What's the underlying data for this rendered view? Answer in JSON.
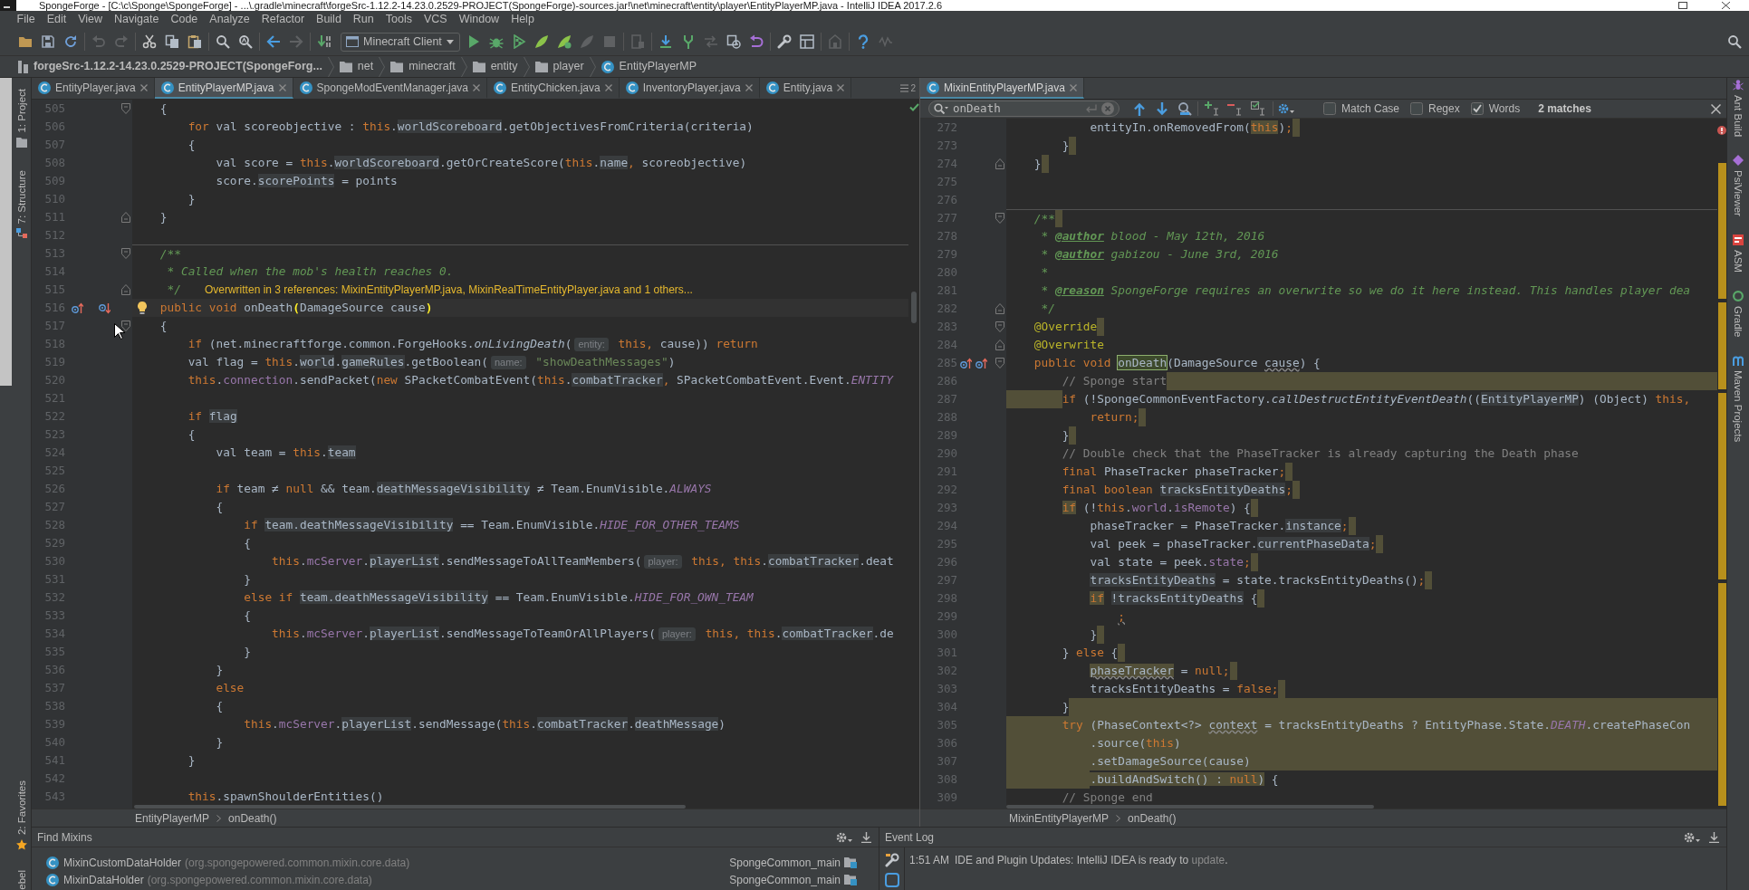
{
  "window": {
    "title": "SpongeForge - [C:\\c\\Sponge\\SpongeForge] - ...\\.gradle\\minecraft\\forgeSrc-1.12.2-14.23.0.2529-PROJECT(SpongeForge)-sources.jar!\\net\\minecraft\\entity\\player\\EntityPlayerMP.java - IntelliJ IDEA 2017.2.6"
  },
  "menu": [
    "File",
    "Edit",
    "View",
    "Navigate",
    "Code",
    "Analyze",
    "Refactor",
    "Build",
    "Run",
    "Tools",
    "VCS",
    "Window",
    "Help"
  ],
  "toolbar": [
    {
      "kind": "open",
      "disabled": false
    },
    {
      "kind": "save",
      "disabled": false
    },
    {
      "kind": "sync",
      "disabled": false
    },
    {
      "kind": "separator"
    },
    {
      "kind": "undo",
      "disabled": true
    },
    {
      "kind": "redo",
      "disabled": true
    },
    {
      "kind": "separator"
    },
    {
      "kind": "cut",
      "disabled": false
    },
    {
      "kind": "copy",
      "disabled": false
    },
    {
      "kind": "paste",
      "disabled": false
    },
    {
      "kind": "separator"
    },
    {
      "kind": "find",
      "disabled": false
    },
    {
      "kind": "replace",
      "disabled": false
    },
    {
      "kind": "separator"
    },
    {
      "kind": "back",
      "disabled": false
    },
    {
      "kind": "forward",
      "disabled": true
    },
    {
      "kind": "separator"
    },
    {
      "kind": "build",
      "disabled": false
    },
    {
      "kind": "run_config",
      "label": "Minecraft Client"
    },
    {
      "kind": "run",
      "disabled": false
    },
    {
      "kind": "debug",
      "disabled": false
    },
    {
      "kind": "coverage",
      "disabled": false
    },
    {
      "kind": "launch",
      "disabled": false
    },
    {
      "kind": "launch_debug",
      "disabled": false
    },
    {
      "kind": "profile",
      "disabled": true
    },
    {
      "kind": "stop",
      "disabled": true
    },
    {
      "kind": "separator"
    },
    {
      "kind": "module",
      "disabled": true
    },
    {
      "kind": "separator"
    },
    {
      "kind": "vcs_update",
      "disabled": false
    },
    {
      "kind": "vcs_commit",
      "disabled": false
    },
    {
      "kind": "compare",
      "disabled": true
    },
    {
      "kind": "history",
      "disabled": false
    },
    {
      "kind": "revert",
      "disabled": false
    },
    {
      "kind": "separator"
    },
    {
      "kind": "settings",
      "disabled": false
    },
    {
      "kind": "structure",
      "disabled": false
    },
    {
      "kind": "separator"
    },
    {
      "kind": "sdk",
      "disabled": true
    },
    {
      "kind": "separator"
    },
    {
      "kind": "help",
      "disabled": false
    },
    {
      "kind": "activity",
      "disabled": true
    },
    {
      "kind": "search_everywhere",
      "disabled": false
    }
  ],
  "navigation": {
    "project": "forgeSrc-1.12.2-14.23.0.2529-PROJECT(SpongeForg...",
    "path": [
      {
        "kind": "folder",
        "label": "net"
      },
      {
        "kind": "folder",
        "label": "minecraft"
      },
      {
        "kind": "folder",
        "label": "entity"
      },
      {
        "kind": "folder",
        "label": "player"
      },
      {
        "kind": "class",
        "label": "EntityPlayerMP"
      }
    ]
  },
  "left_strip": {
    "top": [
      {
        "kind": "project",
        "label": "1: Project"
      },
      {
        "kind": "structure",
        "label": "7: Structure"
      }
    ],
    "bottom": [
      {
        "kind": "favorites",
        "label": "2: Favorites"
      },
      {
        "label": "ebel"
      }
    ]
  },
  "right_strip": [
    {
      "kind": "ant",
      "label": "Ant Build"
    },
    {
      "kind": "psi",
      "label": "PsiViewer"
    },
    {
      "kind": "asm",
      "label": "ASM"
    },
    {
      "kind": "gradle",
      "label": "Gradle"
    },
    {
      "kind": "maven",
      "label": "Maven Projects"
    }
  ],
  "editors": [
    {
      "tabs": [
        {
          "label": "EntityPlayer.java",
          "selected": false
        },
        {
          "label": "EntityPlayerMP.java",
          "selected": true
        },
        {
          "label": "SpongeModEventManager.java",
          "selected": false
        },
        {
          "label": "EntityChicken.java",
          "selected": false
        },
        {
          "label": "InventoryPlayer.java",
          "selected": false
        },
        {
          "label": "Entity.java",
          "selected": false
        }
      ],
      "hidden_tab_count": "2",
      "status": {
        "kind": "ok"
      },
      "lines": [
        {
          "number": "505",
          "fold": {
            "kind": "start"
          },
          "code": [
            {
              "text": "    {"
            }
          ]
        },
        {
          "number": "506",
          "code": [
            {
              "text": "        for",
              "kind": "keyword"
            },
            {
              "text": " val scoreobjective : "
            },
            {
              "text": "this",
              "kind": "keyword"
            },
            {
              "text": "."
            },
            {
              "text": "worldScoreboard",
              "folded": true
            },
            {
              "text": ".getObjectivesFromCriteria(criteria)"
            }
          ]
        },
        {
          "number": "507",
          "code": [
            {
              "text": "        {"
            }
          ]
        },
        {
          "number": "508",
          "code": [
            {
              "text": "            val score = "
            },
            {
              "text": "this",
              "kind": "keyword"
            },
            {
              "text": "."
            },
            {
              "text": "worldScoreboard",
              "folded": true
            },
            {
              "text": ".getOrCreateScore("
            },
            {
              "text": "this",
              "kind": "keyword"
            },
            {
              "text": "."
            },
            {
              "text": "name",
              "folded": true
            },
            {
              "text": ",",
              "kind": "keyword"
            },
            {
              "text": " scoreobjective)"
            }
          ]
        },
        {
          "number": "509",
          "code": [
            {
              "text": "            score."
            },
            {
              "text": "scorePoints",
              "folded": true
            },
            {
              "text": " = points"
            }
          ]
        },
        {
          "number": "510",
          "code": [
            {
              "text": "        }"
            }
          ]
        },
        {
          "number": "511",
          "fold": {
            "kind": "end"
          },
          "code": [
            {
              "text": "    }"
            }
          ]
        },
        {
          "number": "512"
        },
        {
          "number": "513",
          "separator": true,
          "fold": {
            "kind": "start"
          },
          "code": [
            {
              "text": "    /**",
              "kind": "doc"
            }
          ]
        },
        {
          "number": "514",
          "code": [
            {
              "text": "     * Called when the mob's health reaches 0.",
              "kind": "doc"
            }
          ]
        },
        {
          "number": "515",
          "fold": {
            "kind": "end"
          },
          "code": [
            {
              "text": "     */",
              "kind": "doc"
            }
          ],
          "inlay": "Overwritten in 3 references: MixinEntityPlayerMP.java, MixinRealTimeEntityPlayer.java and 1 others..."
        },
        {
          "number": "516",
          "current": true,
          "gutter": [
            {
              "kind": "up"
            },
            {
              "kind": "down"
            }
          ],
          "bulb": true,
          "code": [
            {
              "text": "    public void",
              "kind": "keyword"
            },
            {
              "text": " onDeath"
            },
            {
              "text": "(",
              "kind": "brace"
            },
            {
              "text": "DamageSource cause"
            },
            {
              "text": ")",
              "kind": "brace"
            }
          ]
        },
        {
          "number": "517",
          "fold": {
            "kind": "start"
          },
          "code": [
            {
              "text": "    {"
            }
          ]
        },
        {
          "number": "518",
          "code": [
            {
              "text": "        if",
              "kind": "keyword"
            },
            {
              "text": " (net.minecraftforge.common.ForgeHooks."
            },
            {
              "text": "onLivingDeath",
              "kind": "static"
            },
            {
              "text": "("
            },
            {
              "text": "entity:",
              "kind": "hint"
            },
            {
              "text": " this,",
              "kind": "keyword"
            },
            {
              "text": " cause)) "
            },
            {
              "text": "return",
              "kind": "keyword"
            }
          ]
        },
        {
          "number": "519",
          "code": [
            {
              "text": "        val flag = "
            },
            {
              "text": "this",
              "kind": "keyword"
            },
            {
              "text": "."
            },
            {
              "text": "world",
              "folded": true
            },
            {
              "text": "."
            },
            {
              "text": "gameRules",
              "folded": true
            },
            {
              "text": ".getBoolean("
            },
            {
              "text": "name:",
              "kind": "hint"
            },
            {
              "text": " \"showDeathMessages\"",
              "kind": "string"
            },
            {
              "text": ")"
            }
          ]
        },
        {
          "number": "520",
          "code": [
            {
              "text": "        this",
              "kind": "keyword"
            },
            {
              "text": "."
            },
            {
              "text": "connection",
              "kind": "field"
            },
            {
              "text": ".sendPacket("
            },
            {
              "text": "new",
              "kind": "keyword"
            },
            {
              "text": " SPacketCombatEvent("
            },
            {
              "text": "this",
              "kind": "keyword"
            },
            {
              "text": "."
            },
            {
              "text": "combatTracker",
              "folded": true
            },
            {
              "text": ",",
              "kind": "keyword"
            },
            {
              "text": " SPacketCombatEvent.Event."
            },
            {
              "text": "ENTITY",
              "kind": "constant"
            }
          ]
        },
        {
          "number": "521"
        },
        {
          "number": "522",
          "code": [
            {
              "text": "        if ",
              "kind": "keyword"
            },
            {
              "text": "flag",
              "folded": true
            }
          ]
        },
        {
          "number": "523",
          "code": [
            {
              "text": "        {"
            }
          ]
        },
        {
          "number": "524",
          "code": [
            {
              "text": "            val team = "
            },
            {
              "text": "this",
              "kind": "keyword"
            },
            {
              "text": "."
            },
            {
              "text": "team",
              "folded": true
            }
          ]
        },
        {
          "number": "525"
        },
        {
          "number": "526",
          "code": [
            {
              "text": "            if ",
              "kind": "keyword"
            },
            {
              "text": "team ≠ "
            },
            {
              "text": "null",
              "kind": "keyword"
            },
            {
              "text": " && team."
            },
            {
              "text": "deathMessageVisibility",
              "folded": true
            },
            {
              "text": " ≠ Team.EnumVisible."
            },
            {
              "text": "ALWAYS",
              "kind": "constant"
            }
          ]
        },
        {
          "number": "527",
          "code": [
            {
              "text": "            {"
            }
          ]
        },
        {
          "number": "528",
          "code": [
            {
              "text": "                if ",
              "kind": "keyword"
            },
            {
              "text": "team.deathMessageVisibility",
              "folded": true
            },
            {
              "text": " == Team.EnumVisible."
            },
            {
              "text": "HIDE_FOR_OTHER_TEAMS",
              "kind": "constant"
            }
          ]
        },
        {
          "number": "529",
          "code": [
            {
              "text": "                {"
            }
          ]
        },
        {
          "number": "530",
          "code": [
            {
              "text": "                    this",
              "kind": "keyword"
            },
            {
              "text": "."
            },
            {
              "text": "mcServer",
              "kind": "field"
            },
            {
              "text": "."
            },
            {
              "text": "playerList",
              "folded": true
            },
            {
              "text": ".sendMessageToAllTeamMembers("
            },
            {
              "text": "player:",
              "kind": "hint"
            },
            {
              "text": " this, this",
              "kind": "keyword"
            },
            {
              "text": "."
            },
            {
              "text": "combatTracker",
              "folded": true
            },
            {
              "text": ".deat"
            }
          ]
        },
        {
          "number": "531",
          "code": [
            {
              "text": "                }"
            }
          ]
        },
        {
          "number": "532",
          "code": [
            {
              "text": "                else if ",
              "kind": "keyword"
            },
            {
              "text": "team.deathMessageVisibility",
              "folded": true
            },
            {
              "text": " == Team.EnumVisible."
            },
            {
              "text": "HIDE_FOR_OWN_TEAM",
              "kind": "constant"
            }
          ]
        },
        {
          "number": "533",
          "code": [
            {
              "text": "                {"
            }
          ]
        },
        {
          "number": "534",
          "code": [
            {
              "text": "                    this",
              "kind": "keyword"
            },
            {
              "text": "."
            },
            {
              "text": "mcServer",
              "kind": "field"
            },
            {
              "text": "."
            },
            {
              "text": "playerList",
              "folded": true
            },
            {
              "text": ".sendMessageToTeamOrAllPlayers("
            },
            {
              "text": "player:",
              "kind": "hint"
            },
            {
              "text": " this, this",
              "kind": "keyword"
            },
            {
              "text": "."
            },
            {
              "text": "combatTracker",
              "folded": true
            },
            {
              "text": ".de"
            }
          ]
        },
        {
          "number": "535",
          "code": [
            {
              "text": "                }"
            }
          ]
        },
        {
          "number": "536",
          "code": [
            {
              "text": "            }"
            }
          ]
        },
        {
          "number": "537",
          "code": [
            {
              "text": "            else",
              "kind": "keyword"
            }
          ]
        },
        {
          "number": "538",
          "code": [
            {
              "text": "            {"
            }
          ]
        },
        {
          "number": "539",
          "code": [
            {
              "text": "                this",
              "kind": "keyword"
            },
            {
              "text": "."
            },
            {
              "text": "mcServer",
              "kind": "field"
            },
            {
              "text": "."
            },
            {
              "text": "playerList",
              "folded": true
            },
            {
              "text": ".sendMessage("
            },
            {
              "text": "this",
              "kind": "keyword"
            },
            {
              "text": "."
            },
            {
              "text": "combatTracker",
              "folded": true
            },
            {
              "text": "."
            },
            {
              "text": "deathMessage",
              "folded": true
            },
            {
              "text": ")"
            }
          ]
        },
        {
          "number": "540",
          "code": [
            {
              "text": "            }"
            }
          ]
        },
        {
          "number": "541",
          "code": [
            {
              "text": "        }"
            }
          ]
        },
        {
          "number": "542"
        },
        {
          "number": "543",
          "code": [
            {
              "text": "        this",
              "kind": "keyword"
            },
            {
              "text": ".spawnShoulderEntities()"
            }
          ]
        }
      ],
      "breadcrumb": [
        "EntityPlayerMP",
        "onDeath()"
      ]
    },
    {
      "tabs": [
        {
          "label": "MixinEntityPlayerMP.java",
          "selected": true
        }
      ],
      "status": {
        "kind": "error"
      },
      "search": {
        "query": "onDeath",
        "options": [
          {
            "label": "Match Case",
            "checked": false
          },
          {
            "label": "Regex",
            "checked": false
          },
          {
            "label": "Words",
            "checked": true
          }
        ],
        "result": "2 matches"
      },
      "lines": [
        {
          "number": "272",
          "band": {
            "kind": "trail"
          },
          "code": [
            {
              "text": "            entityIn.onRemovedFrom("
            },
            {
              "text": "this",
              "kind": "keyword",
              "highlighted": true
            },
            {
              "text": ")"
            },
            {
              "text": ";",
              "kind": "keyword"
            }
          ]
        },
        {
          "number": "273",
          "band": {
            "kind": "trail"
          },
          "code": [
            {
              "text": "        }"
            }
          ]
        },
        {
          "number": "274",
          "band": {
            "kind": "trail"
          },
          "fold": {
            "kind": "end"
          },
          "code": [
            {
              "text": "    }"
            }
          ]
        },
        {
          "number": "275"
        },
        {
          "number": "276"
        },
        {
          "number": "277",
          "separator": true,
          "fold": {
            "kind": "start"
          },
          "band": {
            "kind": "trail"
          },
          "code": [
            {
              "text": "    /**",
              "kind": "doc"
            }
          ]
        },
        {
          "number": "278",
          "code": [
            {
              "text": "     * ",
              "kind": "doc"
            },
            {
              "text": "@author",
              "kind": "doctag"
            },
            {
              "text": " blood - May 12th, 2016",
              "kind": "doc"
            }
          ]
        },
        {
          "number": "279",
          "code": [
            {
              "text": "     * ",
              "kind": "doc"
            },
            {
              "text": "@author",
              "kind": "doctag"
            },
            {
              "text": " gabizou - June 3rd, 2016",
              "kind": "doc"
            }
          ]
        },
        {
          "number": "280",
          "code": [
            {
              "text": "     *",
              "kind": "doc"
            }
          ]
        },
        {
          "number": "281",
          "code": [
            {
              "text": "     * ",
              "kind": "doc"
            },
            {
              "text": "@reason",
              "kind": "doctag"
            },
            {
              "text": " SpongeForge requires an overwrite so we do it here instead. This handles player dea",
              "kind": "doc"
            }
          ]
        },
        {
          "number": "282",
          "fold": {
            "kind": "end"
          },
          "code": [
            {
              "text": "     */",
              "kind": "doc"
            }
          ]
        },
        {
          "number": "283",
          "fold": {
            "kind": "start"
          },
          "band": {
            "kind": "trail"
          },
          "code": [
            {
              "text": "    @Override",
              "kind": "annotation"
            }
          ]
        },
        {
          "number": "284",
          "fold": {
            "kind": "end"
          },
          "code": [
            {
              "text": "    @Overwrite",
              "kind": "annotation"
            }
          ]
        },
        {
          "number": "285",
          "fold": {
            "kind": "start"
          },
          "gutter": [
            {
              "kind": "up"
            },
            {
              "kind": "up"
            }
          ],
          "code": [
            {
              "text": "    public void ",
              "kind": "keyword"
            },
            {
              "text": "onDeath",
              "match": true
            },
            {
              "text": "(DamageSource "
            },
            {
              "text": "cause",
              "warning": true
            },
            {
              "text": ") {"
            }
          ]
        },
        {
          "number": "286",
          "band": {
            "kind": "tail"
          },
          "code": [
            {
              "text": "        // Sponge start",
              "kind": "comment"
            }
          ]
        },
        {
          "number": "287",
          "band": {
            "kind": "lead"
          },
          "code": [
            {
              "text": "        if",
              "kind": "keyword"
            },
            {
              "text": " (!SpongeCommonEventFactory."
            },
            {
              "text": "callDestructEntityEventDeath",
              "kind": "static"
            },
            {
              "text": "(("
            },
            {
              "text": "EntityPlayerMP",
              "folded": true
            },
            {
              "text": ") (Object) "
            },
            {
              "text": "this,",
              "kind": "keyword"
            }
          ]
        },
        {
          "number": "288",
          "band": {
            "kind": "trail"
          },
          "code": [
            {
              "text": "            return;",
              "kind": "keyword"
            }
          ]
        },
        {
          "number": "289",
          "band": {
            "kind": "trail"
          },
          "code": [
            {
              "text": "        }"
            }
          ]
        },
        {
          "number": "290",
          "code": [
            {
              "text": "        // Double check that the PhaseTracker is already capturing the Death phase",
              "kind": "comment"
            }
          ]
        },
        {
          "number": "291",
          "band": {
            "kind": "trail"
          },
          "code": [
            {
              "text": "        final",
              "kind": "keyword"
            },
            {
              "text": " PhaseTracker phaseTracker"
            },
            {
              "text": ";",
              "kind": "keyword"
            }
          ]
        },
        {
          "number": "292",
          "band": {
            "kind": "trail"
          },
          "code": [
            {
              "text": "        final boolean ",
              "kind": "keyword"
            },
            {
              "text": "tracksEntityDeaths",
              "folded": true
            },
            {
              "text": ";",
              "kind": "keyword"
            }
          ]
        },
        {
          "number": "293",
          "band": {
            "kind": "trail"
          },
          "code": [
            {
              "text": "        if",
              "kind": "keyword",
              "highlighted": true
            },
            {
              "text": " (!"
            },
            {
              "text": "this",
              "kind": "keyword"
            },
            {
              "text": "."
            },
            {
              "text": "world",
              "kind": "field"
            },
            {
              "text": "."
            },
            {
              "text": "isRemote",
              "kind": "field"
            },
            {
              "text": ") {"
            }
          ]
        },
        {
          "number": "294",
          "band": {
            "kind": "trail"
          },
          "code": [
            {
              "text": "            phaseTracker = PhaseTracker."
            },
            {
              "text": "instance",
              "folded": true
            },
            {
              "text": ";",
              "kind": "keyword"
            }
          ]
        },
        {
          "number": "295",
          "band": {
            "kind": "trail"
          },
          "code": [
            {
              "text": "            val peek = phaseTracker."
            },
            {
              "text": "currentPhaseData",
              "folded": true
            },
            {
              "text": ";",
              "kind": "keyword"
            }
          ]
        },
        {
          "number": "296",
          "band": {
            "kind": "trail"
          },
          "code": [
            {
              "text": "            val state = peek."
            },
            {
              "text": "state",
              "kind": "field"
            },
            {
              "text": ";",
              "kind": "keyword"
            }
          ]
        },
        {
          "number": "297",
          "band": {
            "kind": "trail"
          },
          "code": [
            {
              "text": "            tracksEntityDeaths",
              "folded": true
            },
            {
              "text": " = state.tracksEntityDeaths()"
            },
            {
              "text": ";",
              "kind": "keyword"
            }
          ]
        },
        {
          "number": "298",
          "band": {
            "kind": "trail"
          },
          "code": [
            {
              "text": "            if",
              "kind": "keyword",
              "highlighted": true
            },
            {
              "text": " !tracksEntityDeaths",
              "folded": true
            },
            {
              "text": " {"
            }
          ]
        },
        {
          "number": "299",
          "code": [
            {
              "text": "                ;",
              "kind": "keyword",
              "warning": true
            }
          ]
        },
        {
          "number": "300",
          "band": {
            "kind": "trail"
          },
          "code": [
            {
              "text": "            }"
            }
          ]
        },
        {
          "number": "301",
          "band": {
            "kind": "trail"
          },
          "code": [
            {
              "text": "        } "
            },
            {
              "text": "else",
              "kind": "keyword"
            },
            {
              "text": " {"
            }
          ]
        },
        {
          "number": "302",
          "band": {
            "kind": "trail"
          },
          "code": [
            {
              "text": "            phaseTracker",
              "highlighted": true,
              "warning": true
            },
            {
              "text": " = "
            },
            {
              "text": "null;",
              "kind": "keyword"
            }
          ]
        },
        {
          "number": "303",
          "band": {
            "kind": "trail"
          },
          "code": [
            {
              "text": "            tracksEntityDeaths = "
            },
            {
              "text": "false;",
              "kind": "keyword"
            }
          ]
        },
        {
          "number": "304",
          "band": {
            "kind": "tail"
          },
          "code": [
            {
              "text": "        }"
            }
          ]
        },
        {
          "number": "305",
          "band": {
            "kind": "full"
          },
          "code": [
            {
              "text": "        try",
              "kind": "keyword"
            },
            {
              "text": " (PhaseContext<?> "
            },
            {
              "text": "context",
              "warning": true
            },
            {
              "text": " = tracksEntityDeaths ? EntityPhase.State."
            },
            {
              "text": "DEATH",
              "kind": "constant"
            },
            {
              "text": ".createPhaseCon"
            }
          ]
        },
        {
          "number": "306",
          "band": {
            "kind": "full"
          },
          "code": [
            {
              "text": "            .source("
            },
            {
              "text": "this",
              "kind": "keyword"
            },
            {
              "text": ")"
            }
          ]
        },
        {
          "number": "307",
          "band": {
            "kind": "full"
          },
          "code": [
            {
              "text": "            .setDamageSource(cause)"
            }
          ]
        },
        {
          "number": "308",
          "band": {
            "kind": "lead"
          },
          "code": [
            {
              "text": "            .buildAndSwitch() : ",
              "highlighted": true
            },
            {
              "text": "null",
              "kind": "keyword",
              "highlighted": true
            },
            {
              "text": ")",
              "highlighted": true
            },
            {
              "text": " {"
            }
          ]
        },
        {
          "number": "309",
          "code": [
            {
              "text": "        // Sponge end",
              "kind": "comment"
            }
          ]
        }
      ],
      "breadcrumb": [
        "MixinEntityPlayerMP",
        "onDeath()"
      ]
    }
  ],
  "find_mixins": {
    "title": "Find Mixins",
    "rows": [
      {
        "name": "MixinCustomDataHolder",
        "package": "(org.spongepowered.common.mixin.core.data)",
        "module": "SpongeCommon_main"
      },
      {
        "name": "MixinDataHolder",
        "package": "(org.spongepowered.common.mixin.core.data)",
        "module": "SpongeCommon_main"
      }
    ]
  },
  "event_log": {
    "title": "Event Log",
    "entries": [
      {
        "time": "1:51 AM",
        "text": "IDE and Plugin Updates: IntelliJ IDEA is ready to ",
        "link": "update",
        "after": "."
      }
    ]
  }
}
